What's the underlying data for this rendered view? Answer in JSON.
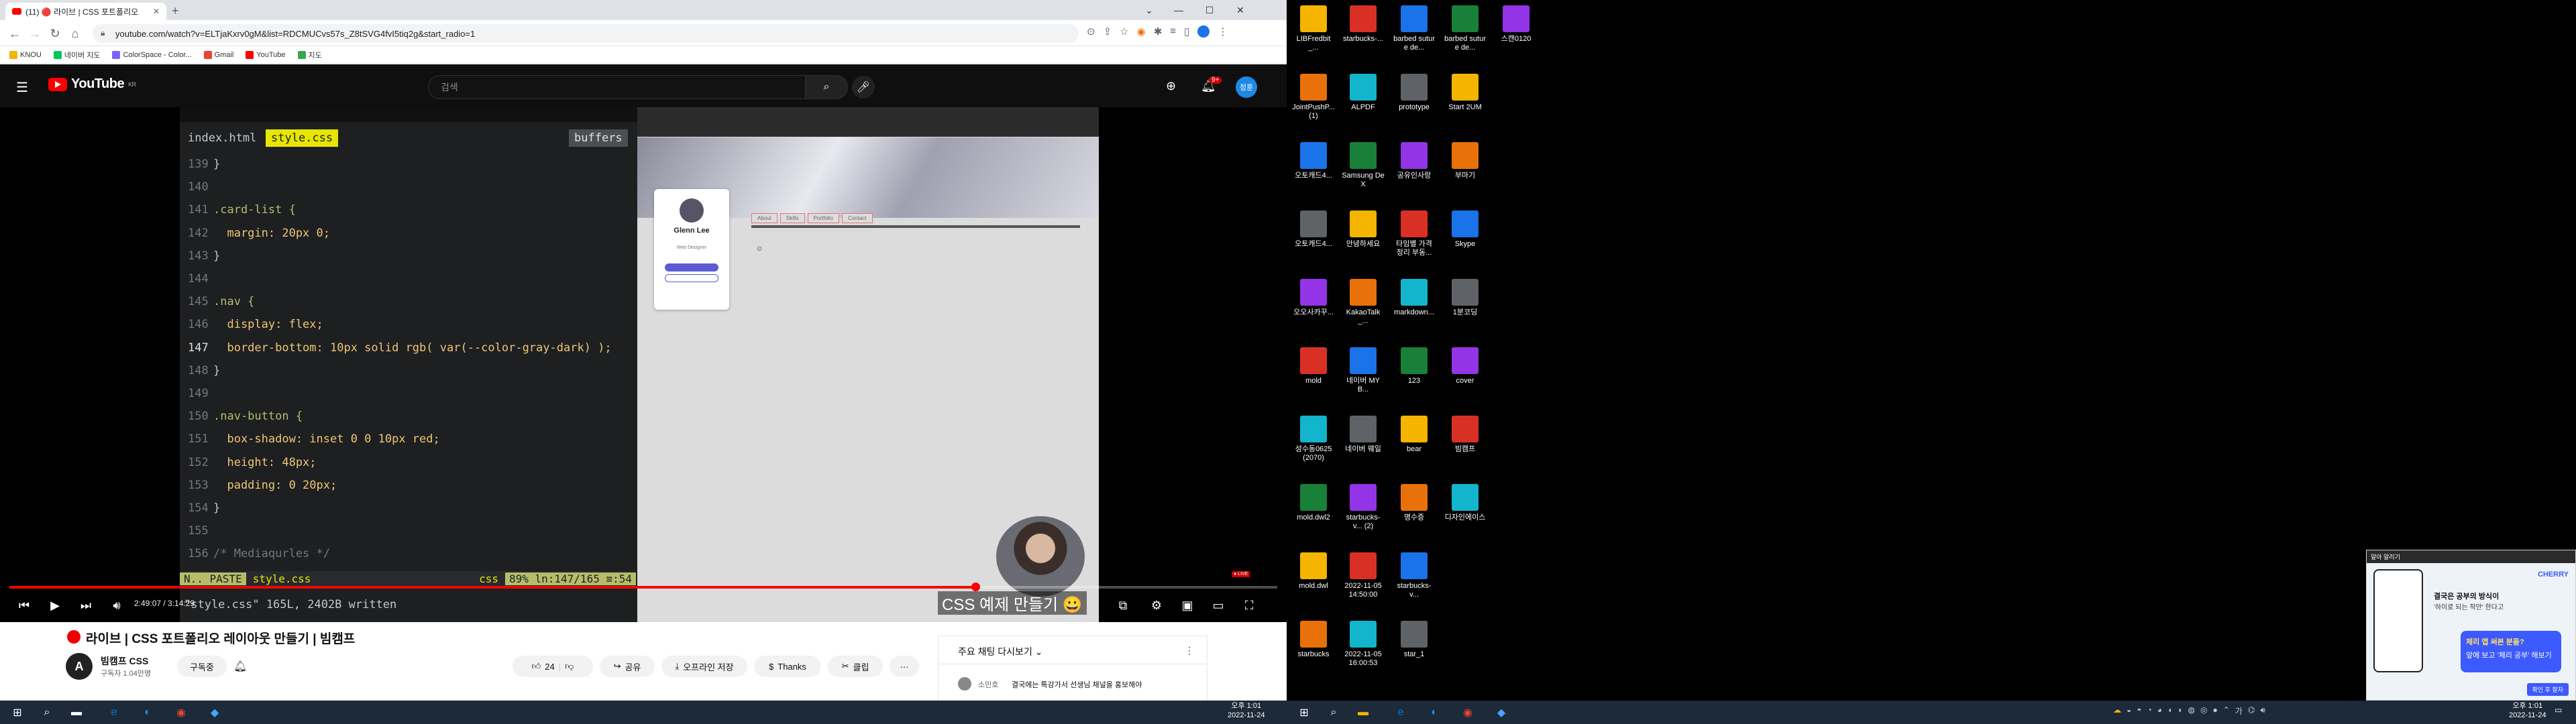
{
  "chrome": {
    "tabs": [
      {
        "label": "(11) 🔴 라이브 | CSS 포트폴리오",
        "active": true
      },
      {
        "label": "+",
        "active": false
      }
    ],
    "url": "youtube.com/watch?v=ELTjaKxrv0gM&list=RDCMUCvs57s_Z8tSVG4fvI5tiq2g&start_radio=1",
    "bookmarks": [
      "KNOU",
      "네이버 지도",
      "ColorSpace - Color...",
      "Gmail",
      "YouTube",
      "지도"
    ]
  },
  "youtube": {
    "logo_text": "YouTube",
    "logo_suffix": "KR",
    "search_placeholder": "검색",
    "notification_count": "9+",
    "avatar_text": "정훈"
  },
  "editor": {
    "tab_index": "index.html",
    "tab_style": "style.css",
    "buffers_label": "buffers",
    "lines": [
      {
        "n": "139",
        "code": "}"
      },
      {
        "n": "140",
        "code": ""
      },
      {
        "n": "141",
        "code": ".card-list {"
      },
      {
        "n": "142",
        "code": "  margin: 20px 0;"
      },
      {
        "n": "143",
        "code": "}"
      },
      {
        "n": "144",
        "code": ""
      },
      {
        "n": "145",
        "code": ".nav {"
      },
      {
        "n": "146",
        "code": "  display: flex;"
      },
      {
        "n": "147",
        "code": "  border-bottom: 10px solid rgb( var(--color-gray-dark) );"
      },
      {
        "n": "148",
        "code": "}"
      },
      {
        "n": "149",
        "code": ""
      },
      {
        "n": "150",
        "code": ".nav-button {"
      },
      {
        "n": "151",
        "code": "  box-shadow: inset 0 0 10px red;"
      },
      {
        "n": "152",
        "code": "  height: 48px;"
      },
      {
        "n": "153",
        "code": "  padding: 0 20px;"
      },
      {
        "n": "154",
        "code": "}"
      },
      {
        "n": "155",
        "code": ""
      },
      {
        "n": "156",
        "code": "/* Mediaqurles */"
      }
    ],
    "status_mode": "N.. PASTE",
    "status_file": "style.css",
    "status_ft": "css",
    "status_pos": "89% ln:147/165 ≡:54",
    "cmdline": "\"style.css\" 165L, 2402B written"
  },
  "preview": {
    "card_name": "Glenn Lee",
    "card_role": "Web Designer",
    "nav_buttons": [
      "About",
      "Skills",
      "Portfolio",
      "Contact"
    ]
  },
  "player": {
    "time": "2:49:07 / 3:14:29",
    "chapter_title": "CSS 예제 만들기",
    "progress_fraction": 0.762
  },
  "video": {
    "title": "라이브 | CSS 포트폴리오 레이아웃 만들기 | 빔캠프",
    "channel_name": "빔캠프 CSS",
    "channel_avatar_letter": "A",
    "subscribers": "구독자 1.04만명",
    "subscribe_label": "구독중",
    "like_count": "24",
    "share_label": "공유",
    "offline_label": "오프라인 저장",
    "thanks_label": "Thanks",
    "clip_label": "클립",
    "more_label": "···",
    "live_chat_title": "주요 채팅 다시보기",
    "chat_user": "소민호",
    "chat_message": "결국에는 특강가서 선생님 채널을 홍보해야"
  },
  "taskbar_left": {
    "time": "오후 1:01",
    "date": "2022-11-24"
  },
  "desktop": {
    "icons": [
      [
        "LIBFredbit_...",
        "starbucks-...",
        "barbed suture de...",
        "barbed suture de...",
        "스캔0120"
      ],
      [
        "JointPushP... (1)",
        "ALPDF",
        "prototype",
        "Start 2UM"
      ],
      [
        "오토캐드4...",
        "Samsung DeX",
        "공유인사랑",
        "부마기"
      ],
      [
        "오토캐드4...",
        "안녕하세요",
        "타임별 가격 정리 부동...",
        "Skype"
      ],
      [
        "오오사카꾸...",
        "KakaoTalk_...",
        "markdown...",
        "1분코딩"
      ],
      [
        "mold",
        "네이버 MYB...",
        "123",
        "cover"
      ],
      [
        "성수동0625 (2070)",
        "네이버 웨일",
        "bear",
        "빔캠프"
      ],
      [
        "mold.dwl2",
        "starbucks-v... (2)",
        "명수증",
        "디자인에이스"
      ],
      [
        "mold.dwl",
        "2022-11-05 14:50:00",
        "starbucks-v..."
      ],
      [
        "starbucks",
        "2022-11-05 16:00:53",
        "star_1"
      ]
    ]
  },
  "ad": {
    "header": "알아 알리기",
    "brand": "CHERRY",
    "line1": "결국은 공부의 방식이",
    "line2": "'하이로 되는 작만' 한다고",
    "headline": "체리 앱 써본 분들?",
    "sub": "앞에 보고 '체리 공부' 해보기",
    "button": "확인 후 잘자"
  },
  "taskbar_right": {
    "time": "오후 1:01",
    "date": "2022-11-24"
  },
  "colors": {
    "youtube_red": "#ff0000",
    "editor_bg": "#1d1f21",
    "taskbar": "#1c2a3a"
  }
}
